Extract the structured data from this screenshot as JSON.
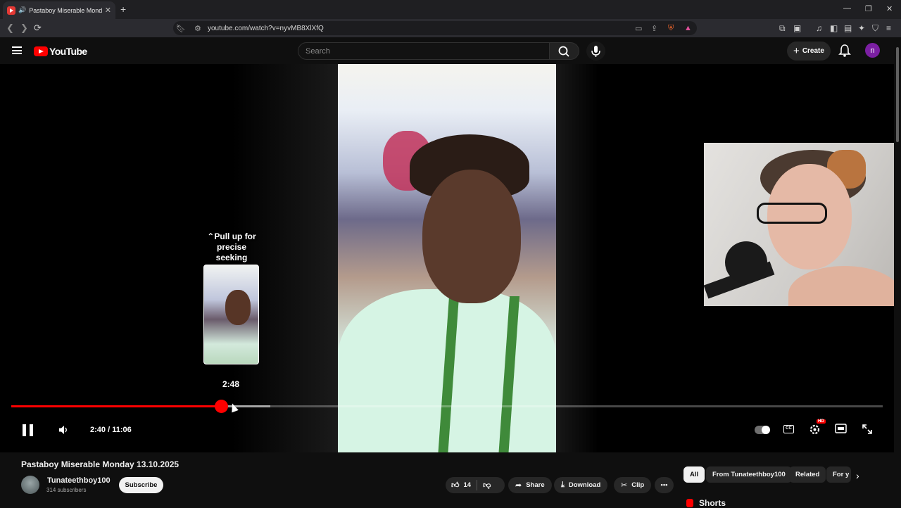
{
  "browser": {
    "tab_title": "Pastaboy Miserable Monday",
    "url": "youtube.com/watch?v=nyvMB8XlXfQ"
  },
  "header": {
    "logo_text": "YouTube",
    "search_placeholder": "Search",
    "create_label": "Create",
    "avatar_letter": "n"
  },
  "player": {
    "preview_hint": "Pull up for precise seeking",
    "preview_time": "2:48",
    "time_current": "2:40",
    "time_separator": " / ",
    "time_total": "11:06",
    "progress_played": 0.241,
    "progress_buffered": 0.297,
    "hd_badge": "HD",
    "cc_label": "CC"
  },
  "video": {
    "title": "Pastaboy Miserable Monday 13.10.2025",
    "channel_name": "Tunateethboy100",
    "subscribers": "314 subscribers",
    "subscribe_label": "Subscribe",
    "like_count": "14",
    "share_label": "Share",
    "download_label": "Download",
    "clip_label": "Clip"
  },
  "related": {
    "chips": [
      "All",
      "From Tunateethboy100",
      "Related",
      "For y"
    ],
    "shorts_heading": "Shorts"
  },
  "colors": {
    "accent": "#ff0000",
    "background": "#0f0f0f",
    "pill": "#272727"
  }
}
